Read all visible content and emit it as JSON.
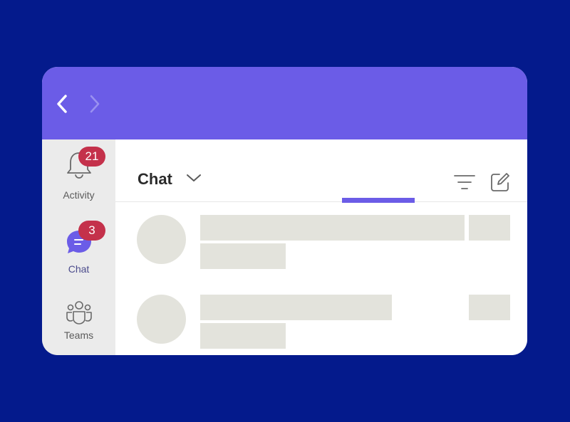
{
  "titlebar": {
    "back_icon": "chevron-left-icon",
    "forward_icon": "chevron-right-icon",
    "color": "#6B5CE7"
  },
  "rail": {
    "items": [
      {
        "label": "Activity",
        "icon": "bell-icon",
        "badge": "21",
        "active": false
      },
      {
        "label": "Chat",
        "icon": "chat-bubble-icon",
        "badge": "3",
        "active": true
      },
      {
        "label": "Teams",
        "icon": "teams-icon",
        "badge": "",
        "active": false
      }
    ]
  },
  "main": {
    "title": "Chat",
    "title_dropdown_icon": "chevron-down-icon",
    "filter_icon": "filter-icon",
    "compose_icon": "compose-icon",
    "accent": "#6B5CE7",
    "list_items": [
      {
        "type": "skeleton-placeholder"
      },
      {
        "type": "skeleton-placeholder"
      }
    ]
  },
  "colors": {
    "background": "#041A8C",
    "badge": "#C4314B",
    "skeleton": "#E3E3DC",
    "rail": "#EBEBEB"
  }
}
